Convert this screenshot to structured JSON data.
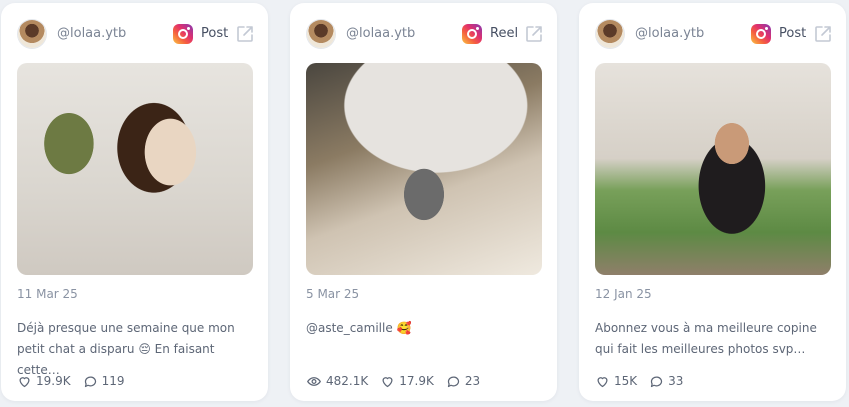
{
  "cards": [
    {
      "handle": "@lolaa.ytb",
      "type_label": "Post",
      "date": "11 Mar 25",
      "caption": "Déjà presque une semaine que mon petit chat a disparu 😔 En faisant cette…",
      "likes": "19.9K",
      "comments": "119"
    },
    {
      "handle": "@lolaa.ytb",
      "type_label": "Reel",
      "date": "5 Mar 25",
      "caption": "@aste_camille 🥰",
      "views": "482.1K",
      "likes": "17.9K",
      "comments": "23"
    },
    {
      "handle": "@lolaa.ytb",
      "type_label": "Post",
      "date": "12 Jan 25",
      "caption": "Abonnez vous à ma meilleure copine qui fait les meilleures photos svp…",
      "likes": "15K",
      "comments": "33"
    }
  ],
  "icons": {
    "platform": "instagram-icon",
    "external": "external-link-icon",
    "likes": "heart-icon",
    "comments": "comment-icon",
    "views": "eye-icon"
  },
  "colors": {
    "page_background": "#eef1f5",
    "card_background": "#ffffff",
    "muted_text": "#7b8494"
  }
}
